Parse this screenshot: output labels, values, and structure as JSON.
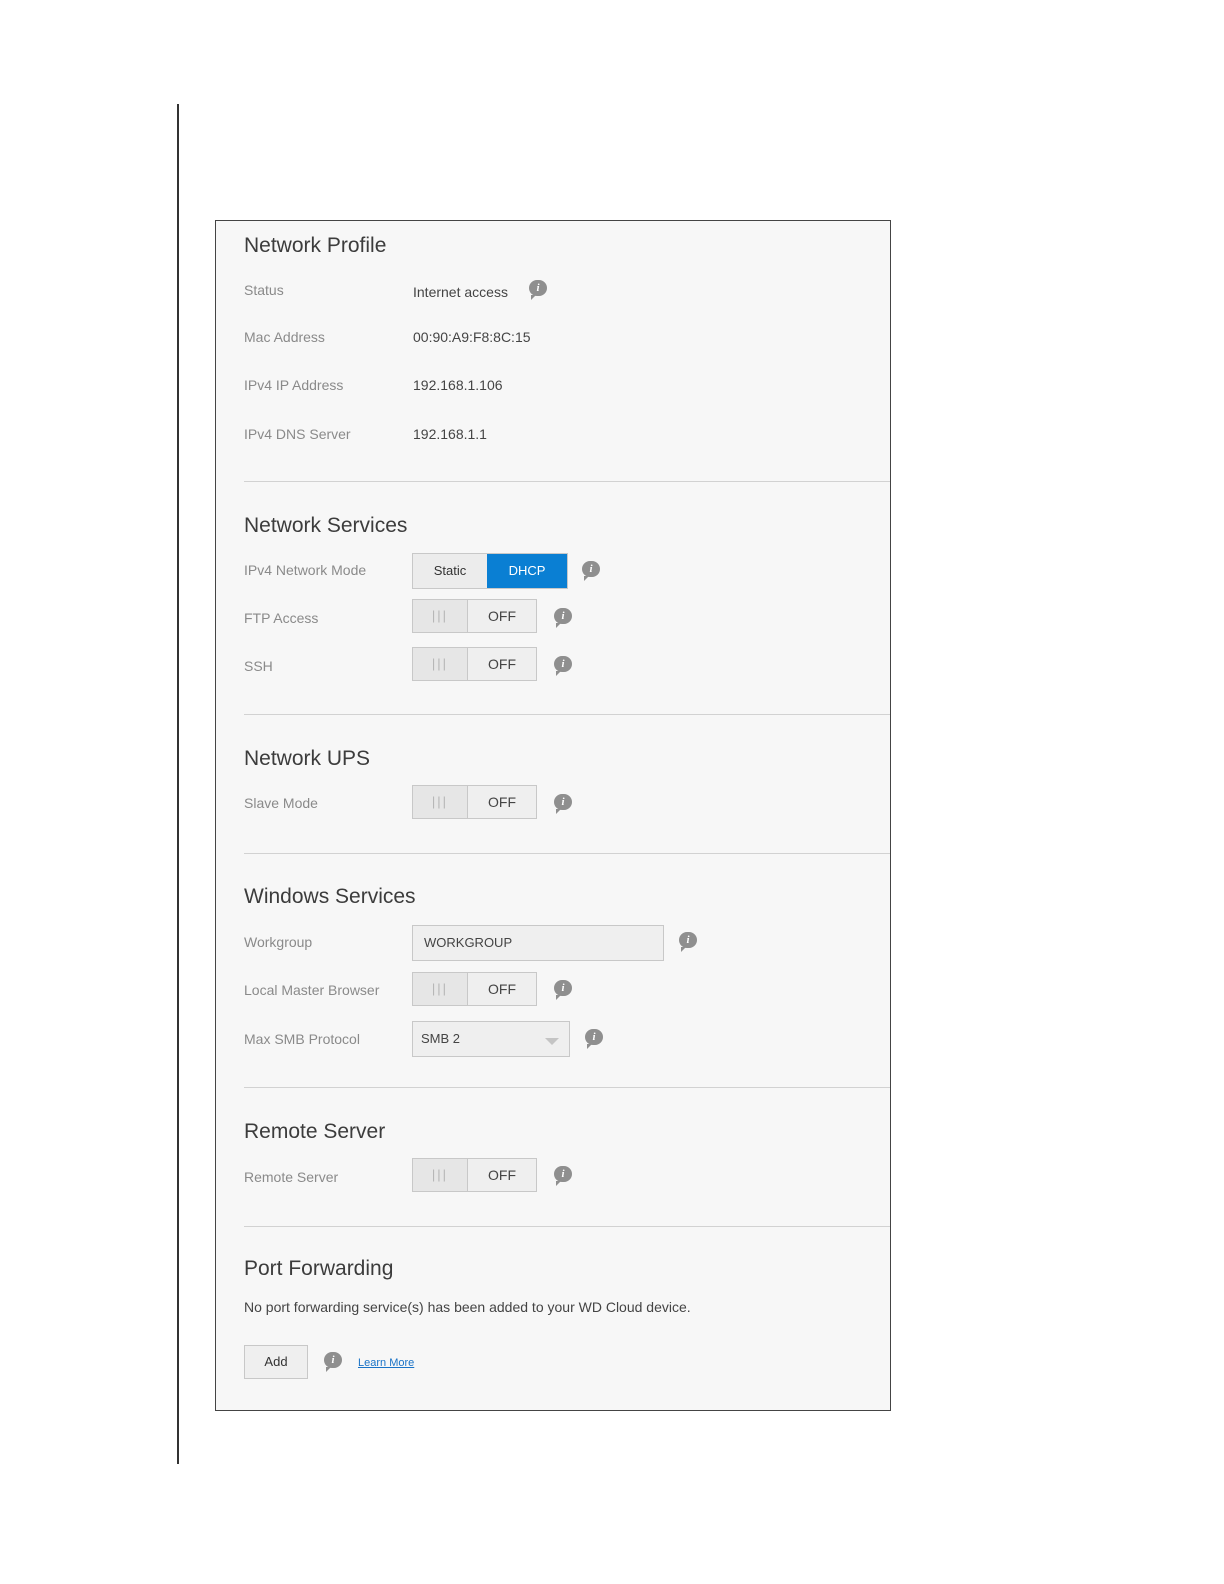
{
  "network_profile": {
    "title": "Network Profile",
    "rows": [
      {
        "label": "Status",
        "value": "Internet access"
      },
      {
        "label": "Mac Address",
        "value": "00:90:A9:F8:8C:15"
      },
      {
        "label": "IPv4 IP Address",
        "value": "192.168.1.106"
      },
      {
        "label": "IPv4 DNS Server",
        "value": "192.168.1.1"
      }
    ]
  },
  "network_services": {
    "title": "Network Services",
    "ipv4_mode": {
      "label": "IPv4 Network Mode",
      "options": [
        "Static",
        "DHCP"
      ],
      "selected": "DHCP"
    },
    "ftp": {
      "label": "FTP Access",
      "state": "OFF"
    },
    "ssh": {
      "label": "SSH",
      "state": "OFF"
    }
  },
  "network_ups": {
    "title": "Network UPS",
    "slave_mode": {
      "label": "Slave Mode",
      "state": "OFF"
    }
  },
  "windows_services": {
    "title": "Windows Services",
    "workgroup": {
      "label": "Workgroup",
      "value": "WORKGROUP"
    },
    "local_master_browser": {
      "label": "Local Master Browser",
      "state": "OFF"
    },
    "max_smb": {
      "label": "Max SMB Protocol",
      "selected": "SMB 2"
    }
  },
  "remote_server": {
    "title": "Remote Server",
    "toggle": {
      "label": "Remote Server",
      "state": "OFF"
    }
  },
  "port_forwarding": {
    "title": "Port Forwarding",
    "message": "No port forwarding service(s) has been added to your WD Cloud device.",
    "add_label": "Add",
    "learn_more": "Learn More"
  },
  "ui": {
    "info_glyph": "i",
    "toggle_knob_glyph": "|||",
    "accent_color": "#0a7fd3",
    "icons": [
      "info-icon",
      "toggle-knob-icon",
      "chevron-down-icon"
    ]
  }
}
